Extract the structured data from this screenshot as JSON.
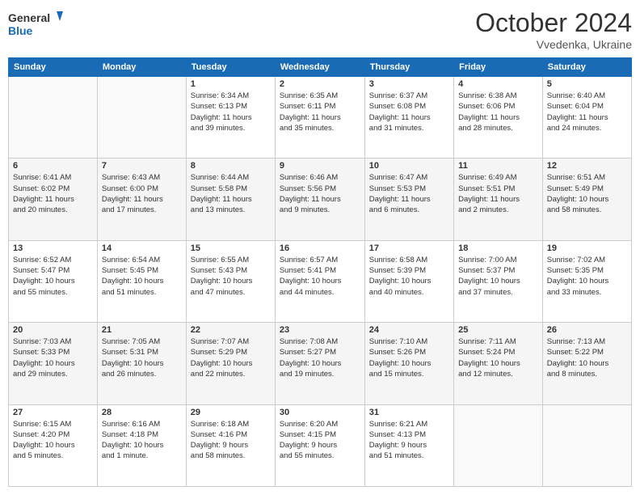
{
  "header": {
    "logo_line1": "General",
    "logo_line2": "Blue",
    "month": "October 2024",
    "location": "Vvedenka, Ukraine"
  },
  "weekdays": [
    "Sunday",
    "Monday",
    "Tuesday",
    "Wednesday",
    "Thursday",
    "Friday",
    "Saturday"
  ],
  "weeks": [
    [
      {
        "day": "",
        "info": ""
      },
      {
        "day": "",
        "info": ""
      },
      {
        "day": "1",
        "info": "Sunrise: 6:34 AM\nSunset: 6:13 PM\nDaylight: 11 hours\nand 39 minutes."
      },
      {
        "day": "2",
        "info": "Sunrise: 6:35 AM\nSunset: 6:11 PM\nDaylight: 11 hours\nand 35 minutes."
      },
      {
        "day": "3",
        "info": "Sunrise: 6:37 AM\nSunset: 6:08 PM\nDaylight: 11 hours\nand 31 minutes."
      },
      {
        "day": "4",
        "info": "Sunrise: 6:38 AM\nSunset: 6:06 PM\nDaylight: 11 hours\nand 28 minutes."
      },
      {
        "day": "5",
        "info": "Sunrise: 6:40 AM\nSunset: 6:04 PM\nDaylight: 11 hours\nand 24 minutes."
      }
    ],
    [
      {
        "day": "6",
        "info": "Sunrise: 6:41 AM\nSunset: 6:02 PM\nDaylight: 11 hours\nand 20 minutes."
      },
      {
        "day": "7",
        "info": "Sunrise: 6:43 AM\nSunset: 6:00 PM\nDaylight: 11 hours\nand 17 minutes."
      },
      {
        "day": "8",
        "info": "Sunrise: 6:44 AM\nSunset: 5:58 PM\nDaylight: 11 hours\nand 13 minutes."
      },
      {
        "day": "9",
        "info": "Sunrise: 6:46 AM\nSunset: 5:56 PM\nDaylight: 11 hours\nand 9 minutes."
      },
      {
        "day": "10",
        "info": "Sunrise: 6:47 AM\nSunset: 5:53 PM\nDaylight: 11 hours\nand 6 minutes."
      },
      {
        "day": "11",
        "info": "Sunrise: 6:49 AM\nSunset: 5:51 PM\nDaylight: 11 hours\nand 2 minutes."
      },
      {
        "day": "12",
        "info": "Sunrise: 6:51 AM\nSunset: 5:49 PM\nDaylight: 10 hours\nand 58 minutes."
      }
    ],
    [
      {
        "day": "13",
        "info": "Sunrise: 6:52 AM\nSunset: 5:47 PM\nDaylight: 10 hours\nand 55 minutes."
      },
      {
        "day": "14",
        "info": "Sunrise: 6:54 AM\nSunset: 5:45 PM\nDaylight: 10 hours\nand 51 minutes."
      },
      {
        "day": "15",
        "info": "Sunrise: 6:55 AM\nSunset: 5:43 PM\nDaylight: 10 hours\nand 47 minutes."
      },
      {
        "day": "16",
        "info": "Sunrise: 6:57 AM\nSunset: 5:41 PM\nDaylight: 10 hours\nand 44 minutes."
      },
      {
        "day": "17",
        "info": "Sunrise: 6:58 AM\nSunset: 5:39 PM\nDaylight: 10 hours\nand 40 minutes."
      },
      {
        "day": "18",
        "info": "Sunrise: 7:00 AM\nSunset: 5:37 PM\nDaylight: 10 hours\nand 37 minutes."
      },
      {
        "day": "19",
        "info": "Sunrise: 7:02 AM\nSunset: 5:35 PM\nDaylight: 10 hours\nand 33 minutes."
      }
    ],
    [
      {
        "day": "20",
        "info": "Sunrise: 7:03 AM\nSunset: 5:33 PM\nDaylight: 10 hours\nand 29 minutes."
      },
      {
        "day": "21",
        "info": "Sunrise: 7:05 AM\nSunset: 5:31 PM\nDaylight: 10 hours\nand 26 minutes."
      },
      {
        "day": "22",
        "info": "Sunrise: 7:07 AM\nSunset: 5:29 PM\nDaylight: 10 hours\nand 22 minutes."
      },
      {
        "day": "23",
        "info": "Sunrise: 7:08 AM\nSunset: 5:27 PM\nDaylight: 10 hours\nand 19 minutes."
      },
      {
        "day": "24",
        "info": "Sunrise: 7:10 AM\nSunset: 5:26 PM\nDaylight: 10 hours\nand 15 minutes."
      },
      {
        "day": "25",
        "info": "Sunrise: 7:11 AM\nSunset: 5:24 PM\nDaylight: 10 hours\nand 12 minutes."
      },
      {
        "day": "26",
        "info": "Sunrise: 7:13 AM\nSunset: 5:22 PM\nDaylight: 10 hours\nand 8 minutes."
      }
    ],
    [
      {
        "day": "27",
        "info": "Sunrise: 6:15 AM\nSunset: 4:20 PM\nDaylight: 10 hours\nand 5 minutes."
      },
      {
        "day": "28",
        "info": "Sunrise: 6:16 AM\nSunset: 4:18 PM\nDaylight: 10 hours\nand 1 minute."
      },
      {
        "day": "29",
        "info": "Sunrise: 6:18 AM\nSunset: 4:16 PM\nDaylight: 9 hours\nand 58 minutes."
      },
      {
        "day": "30",
        "info": "Sunrise: 6:20 AM\nSunset: 4:15 PM\nDaylight: 9 hours\nand 55 minutes."
      },
      {
        "day": "31",
        "info": "Sunrise: 6:21 AM\nSunset: 4:13 PM\nDaylight: 9 hours\nand 51 minutes."
      },
      {
        "day": "",
        "info": ""
      },
      {
        "day": "",
        "info": ""
      }
    ]
  ]
}
